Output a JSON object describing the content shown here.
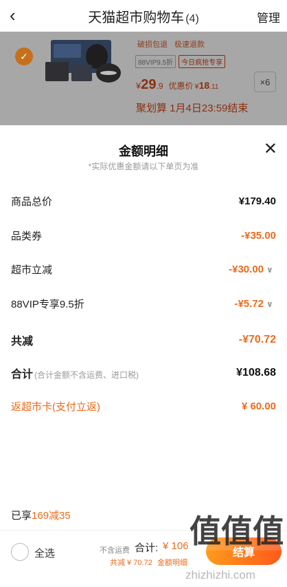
{
  "header": {
    "back_icon": "chevron-left-icon",
    "title": "天猫超市购物车",
    "count": "(4)",
    "manage": "管理"
  },
  "product": {
    "tags": [
      "破损包退",
      "极速退款"
    ],
    "badges": [
      "88VIP9.5折",
      "今日疯抢专享"
    ],
    "price_yen": "¥",
    "price_int": "29",
    "price_dec": ".9",
    "promo_label": "优惠价",
    "promo_yen": "¥",
    "promo_int": "18",
    "promo_dec": ".11",
    "quantity": "×6",
    "deal_text": "聚划算 1月4日23:59结束"
  },
  "panel": {
    "title": "金额明细",
    "subtitle": "*实际优惠金额请以下单页为准",
    "rows": [
      {
        "label": "商品总价",
        "value": "¥179.40"
      },
      {
        "label": "品类券",
        "value": "-¥35.00"
      },
      {
        "label": "超市立减",
        "value": "-¥30.00"
      },
      {
        "label": "88VIP专享9.5折",
        "value": "-¥5.72"
      },
      {
        "label": "共减",
        "value": "-¥70.72"
      },
      {
        "label": "合计",
        "note": "(合计金额不含运费、进口税)",
        "value": "¥108.68"
      },
      {
        "label": "返超市卡(支付立返)",
        "value": "¥ 60.00"
      }
    ],
    "enjoy_prefix": "已享",
    "enjoy_highlight": "169减35"
  },
  "bottom_bar": {
    "select_all": "全选",
    "excl_shipping": "不含运费",
    "total_label": "合计:",
    "total_amount": "¥ 106",
    "reduce_text": "共减 ¥ 70.72",
    "detail_label": "金额明细",
    "checkout": "结算"
  },
  "watermark": {
    "logo_text": "值值值",
    "url": "zhizhizhi.com"
  },
  "colors": {
    "accent": "#ee6a1a",
    "dim_overlay": "#a7a7a7",
    "checkbox_checked": "#c7701c"
  }
}
